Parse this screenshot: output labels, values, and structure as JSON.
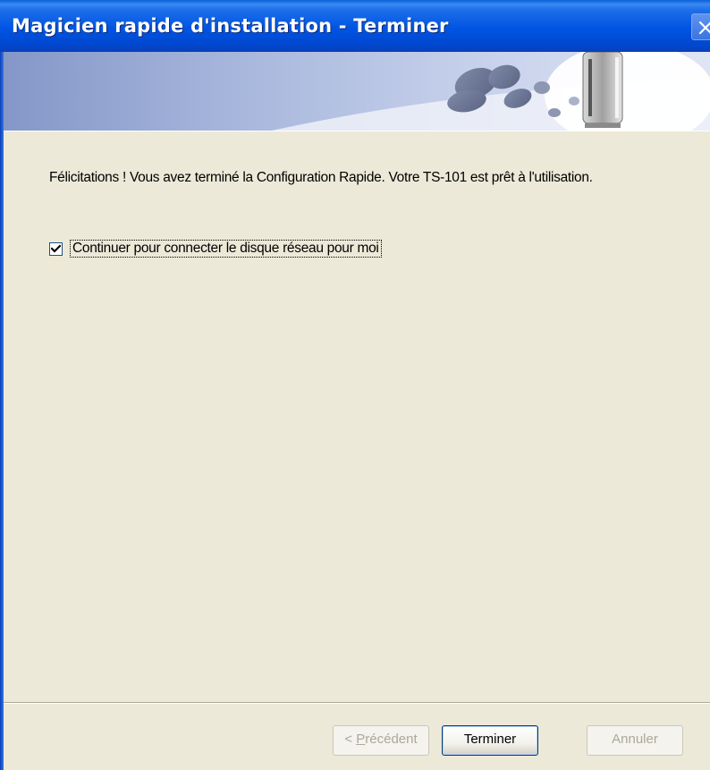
{
  "window": {
    "title": "Magicien rapide d'installation - Terminer"
  },
  "content": {
    "message": "Félicitations ! Vous avez terminé la Configuration Rapide. Votre TS-101 est prêt à l'utilisation.",
    "checkbox": {
      "label": "Continuer pour connecter le disque réseau pour moi",
      "checked": true
    }
  },
  "buttons": {
    "previous": {
      "mnemonic": "P",
      "rest": "récédent",
      "prefix": "< ",
      "enabled": false
    },
    "finish": {
      "label": "Terminer",
      "enabled": true
    },
    "cancel": {
      "label": "Annuler",
      "enabled": false
    }
  },
  "icons": {
    "close": "close-icon",
    "device": "nas-device-icon",
    "checkmark": "checkmark-icon"
  },
  "colors": {
    "titlebar": "#0054e3",
    "dialog_bg": "#ece9d8",
    "banner": "#a9b8dd"
  }
}
